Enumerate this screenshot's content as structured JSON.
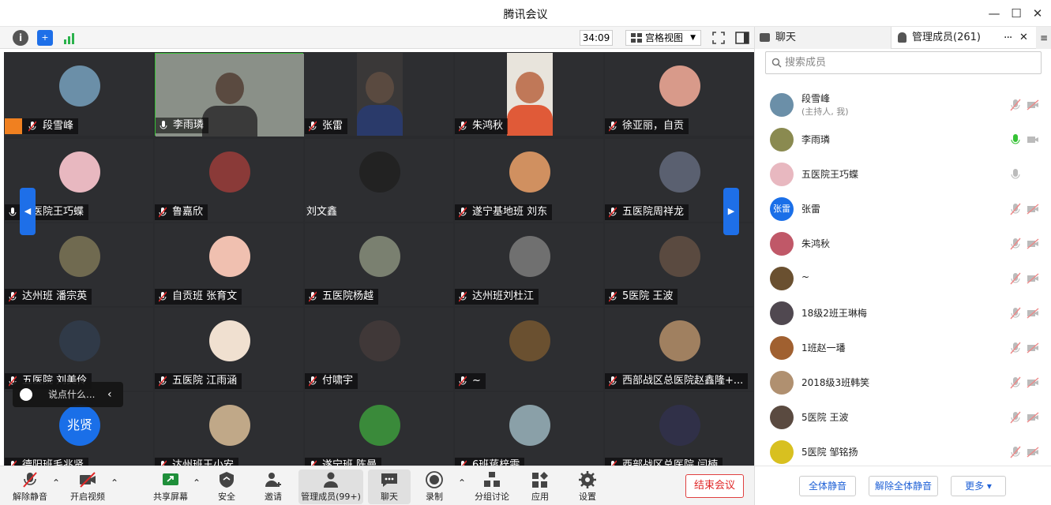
{
  "window": {
    "title": "腾讯会议"
  },
  "toolbar": {
    "timer": "34:09",
    "view_label": "宫格视图"
  },
  "grid": {
    "cells": [
      {
        "name": "段雪峰",
        "avatar": "#6b8fa8"
      },
      {
        "name": "李雨璘",
        "avatar": "#8a8f88"
      },
      {
        "name": "张雷",
        "avatar": "#4a4a48"
      },
      {
        "name": "朱鸿秋",
        "avatar": "#e07050"
      },
      {
        "name": "徐亚丽，自贡",
        "avatar": "#d89a8a"
      },
      {
        "name": "五医院王巧蝶",
        "avatar": "#e8b8c0"
      },
      {
        "name": "鲁嘉欣",
        "avatar": "#8a3a38"
      },
      {
        "name": "刘文鑫",
        "avatar": "#222"
      },
      {
        "name": "遂宁基地班 刘东",
        "avatar": "#d09060"
      },
      {
        "name": "五医院周祥龙",
        "avatar": "#5a6070"
      },
      {
        "name": "达州班 潘宗英",
        "avatar": "#706a50"
      },
      {
        "name": "自贡班 张育文",
        "avatar": "#f0c0b0"
      },
      {
        "name": "五医院杨越",
        "avatar": "#7a8070"
      },
      {
        "name": "达州班刘杜江",
        "avatar": "#707070"
      },
      {
        "name": "5医院  王波",
        "avatar": "#5a4a40"
      },
      {
        "name": "五医院 刘美伶",
        "avatar": "#303a48"
      },
      {
        "name": "五医院 江雨涵",
        "avatar": "#f0e0d0"
      },
      {
        "name": "付啸宇",
        "avatar": "#403838"
      },
      {
        "name": "~",
        "avatar": "#6a5030"
      },
      {
        "name": "西部战区总医院赵鑫隆+...",
        "avatar": "#a08060"
      },
      {
        "name": "德阳班毛兆贤",
        "avatar": "#1a6fe8",
        "initials": "兆贤"
      },
      {
        "name": "达州班王小安",
        "avatar": "#c0a888"
      },
      {
        "name": "遂宁班 陈曼",
        "avatar": "#3a8a3a"
      },
      {
        "name": "6班蒋梓雯",
        "avatar": "#8aa0a8"
      },
      {
        "name": "西部战区总医院 闫楠",
        "avatar": "#303048"
      }
    ]
  },
  "chat_pill": {
    "placeholder": "说点什么..."
  },
  "bottom": {
    "unmute": "解除静音",
    "start_video": "开启视频",
    "share": "共享屏幕",
    "security": "安全",
    "invite": "邀请",
    "members": "管理成员(99+)",
    "chat": "聊天",
    "record": "录制",
    "breakout": "分组讨论",
    "apps": "应用",
    "settings": "设置",
    "end": "结束会议"
  },
  "sidebar": {
    "tab_chat": "聊天",
    "tab_members": "管理成员(261)",
    "search_placeholder": "搜索成员",
    "members": [
      {
        "name": "段雪峰",
        "sub": "(主持人, 我)",
        "avatar": "#6b8fa8"
      },
      {
        "name": "李雨璘",
        "avatar": "#8a8a50"
      },
      {
        "name": "五医院王巧蝶",
        "avatar": "#e8b8c0"
      },
      {
        "name": "张雷",
        "avatar": "#1a6fe8",
        "initials": "张雷"
      },
      {
        "name": "朱鸿秋",
        "avatar": "#c05868"
      },
      {
        "name": "~",
        "avatar": "#6a5030"
      },
      {
        "name": "18级2班王琳梅",
        "avatar": "#504850"
      },
      {
        "name": "1班赵一璠",
        "avatar": "#a06030"
      },
      {
        "name": "2018级3班韩笑",
        "avatar": "#b09070"
      },
      {
        "name": "5医院  王波",
        "avatar": "#5a4a40"
      },
      {
        "name": "5医院 邹铭扬",
        "avatar": "#d8c020"
      }
    ],
    "mute_all": "全体静音",
    "unmute_all": "解除全体静音",
    "more": "更多"
  },
  "colors": {
    "accent": "#1e6fe8",
    "danger": "#e02828",
    "speaking": "#35c235"
  }
}
